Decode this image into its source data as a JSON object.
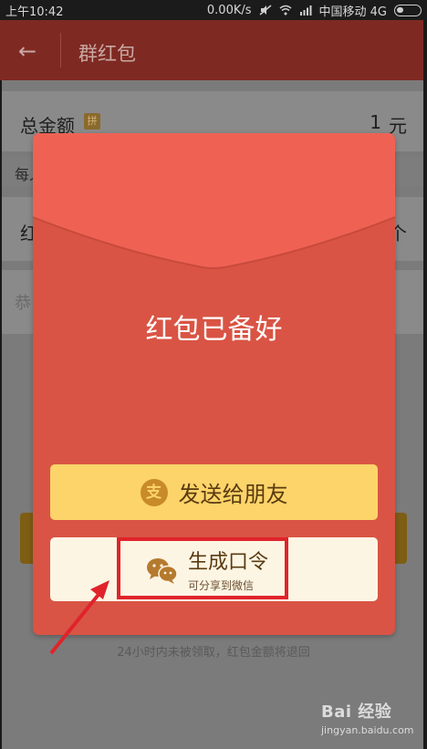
{
  "status_bar": {
    "time": "上午10:42",
    "network_speed": "0.00K/s",
    "carrier": "中国移动 4G"
  },
  "header": {
    "back_icon": "arrow-left-icon",
    "title": "群红包"
  },
  "form": {
    "total_label": "总金额",
    "pin_badge": "拼",
    "total_amount": "1",
    "total_unit": "元",
    "each_label": "每人",
    "count_label": "红",
    "count_unit": "个",
    "message_placeholder": "恭"
  },
  "notice": "24小时内未被领取，红包金额将退回",
  "modal": {
    "title": "红包已备好",
    "send_button": {
      "icon": "alipay-icon",
      "label": "发送给朋友"
    },
    "code_button": {
      "icon": "wechat-icon",
      "label": "生成口令",
      "sublabel": "可分享到微信"
    }
  },
  "watermark": {
    "brand": "Bai 经验",
    "url": "jingyan.baidu.com"
  },
  "colors": {
    "packet_red": "#d95444",
    "flap_red": "#ef6253",
    "send_yellow": "#fcd46a",
    "highlight_red": "#e0232b"
  }
}
